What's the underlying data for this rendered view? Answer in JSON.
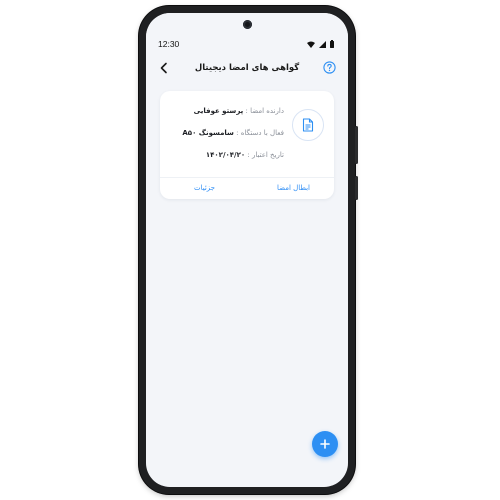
{
  "status_bar": {
    "time": "12:30",
    "icons": [
      "wifi-icon",
      "signal-icon",
      "battery-icon"
    ]
  },
  "app_bar": {
    "title": "گواهی های امضا دیجیتال",
    "back_icon": "chevron-left-icon",
    "help_icon": "question-circle-icon"
  },
  "certificate": {
    "icon": "document-icon",
    "holder_label": "دارنده امضا :",
    "holder_value": "پرستو عوفایی",
    "device_label": "فعال با دستگاه :",
    "device_value": "سامسونگ A۵۰",
    "expiry_label": "تاریخ اعتبار :",
    "expiry_value": "۱۴۰۲/۰۴/۲۰",
    "revoke_label": "ابطال امضا",
    "details_label": "جزئیات"
  },
  "fab": {
    "icon": "plus-icon"
  },
  "colors": {
    "accent": "#2d8ff3",
    "background": "#f3f5f9",
    "card": "#ffffff",
    "phone_frame": "#1f2022"
  }
}
